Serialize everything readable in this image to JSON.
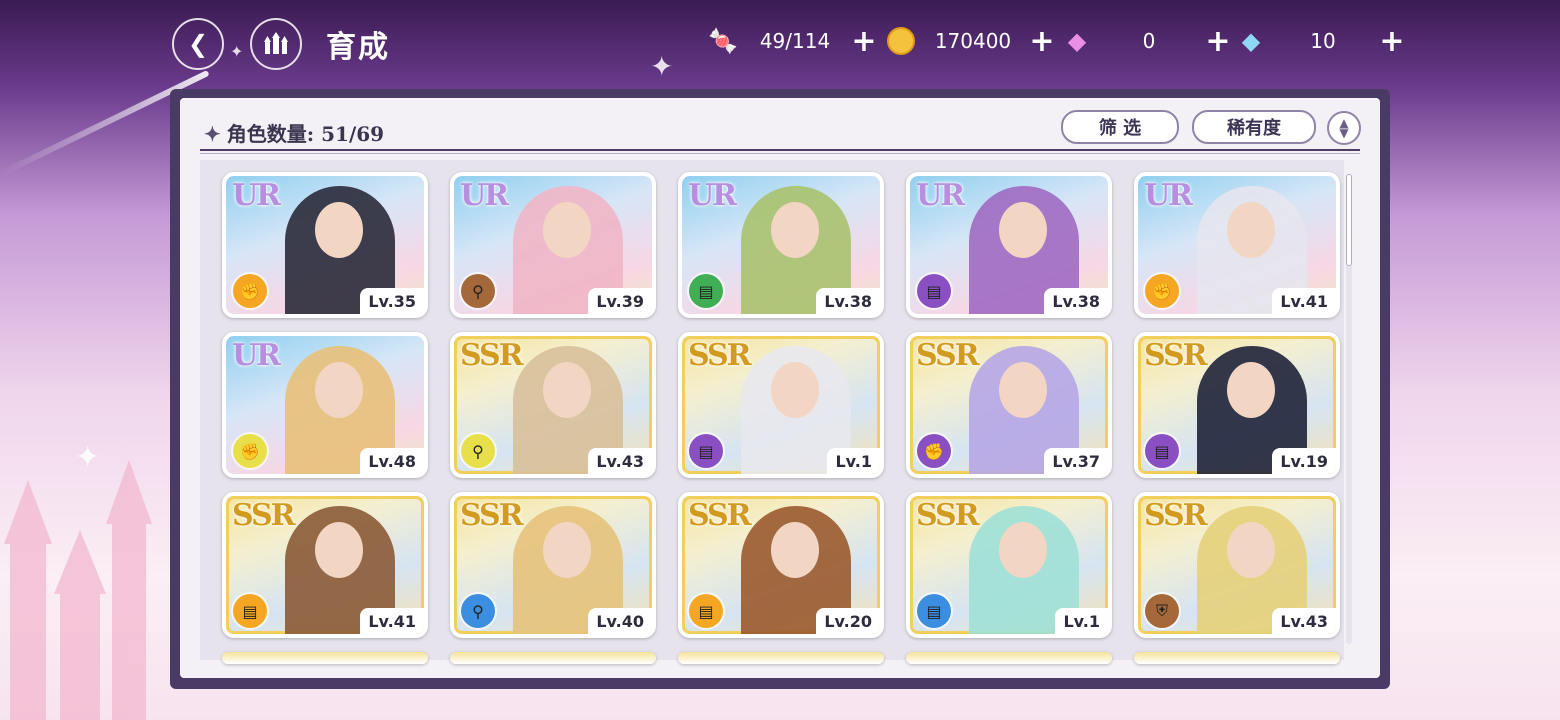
{
  "header": {
    "title": "育成",
    "resources": [
      {
        "icon": "candy-icon",
        "value": "49/114"
      },
      {
        "icon": "gold-coin-icon",
        "value": "170400"
      },
      {
        "icon": "pink-gem-icon",
        "value": "0"
      },
      {
        "icon": "blue-diamond-icon",
        "value": "10"
      }
    ]
  },
  "panel": {
    "count_label": "角色数量: 51/69",
    "filter_label": "筛 选",
    "sort_label": "稀有度"
  },
  "colors": {
    "ur_label": "#b88fe0",
    "ssr_label": "#d29a1e",
    "panel_border": "#4a3a66",
    "role_orange": "#f5a623",
    "role_brown": "#a4683a",
    "role_green": "#3fae55",
    "role_purple": "#8a4fc2",
    "role_yellow": "#e8e04a",
    "role_blue": "#3b8ee0"
  },
  "cards": [
    {
      "rarity": "UR",
      "level": "Lv.35",
      "role": "orange",
      "role_icon": "fist-icon",
      "hair": "#2a2a3a"
    },
    {
      "rarity": "UR",
      "level": "Lv.39",
      "role": "brown",
      "role_icon": "staff-icon",
      "hair": "#efb6c6"
    },
    {
      "rarity": "UR",
      "level": "Lv.38",
      "role": "green",
      "role_icon": "book-icon",
      "hair": "#a8c26e"
    },
    {
      "rarity": "UR",
      "level": "Lv.38",
      "role": "purple",
      "role_icon": "book-icon",
      "hair": "#a06ac2"
    },
    {
      "rarity": "UR",
      "level": "Lv.41",
      "role": "orange",
      "role_icon": "fist-icon",
      "hair": "#e6e6ee"
    },
    {
      "rarity": "UR",
      "level": "Lv.48",
      "role": "yellow",
      "role_icon": "fist-icon",
      "hair": "#e8c07a"
    },
    {
      "rarity": "SSR",
      "level": "Lv.43",
      "role": "yellow",
      "role_icon": "staff-icon",
      "hair": "#d8c09a"
    },
    {
      "rarity": "SSR",
      "level": "Lv.1",
      "role": "purple",
      "role_icon": "book-icon",
      "hair": "#e8e8ee"
    },
    {
      "rarity": "SSR",
      "level": "Lv.37",
      "role": "purple",
      "role_icon": "fist-icon",
      "hair": "#b6a6e6"
    },
    {
      "rarity": "SSR",
      "level": "Lv.19",
      "role": "purple",
      "role_icon": "book-icon",
      "hair": "#1e2238"
    },
    {
      "rarity": "SSR",
      "level": "Lv.41",
      "role": "orange",
      "role_icon": "book-icon",
      "hair": "#8a5a36"
    },
    {
      "rarity": "SSR",
      "level": "Lv.40",
      "role": "blue",
      "role_icon": "staff-icon",
      "hair": "#e6c27a"
    },
    {
      "rarity": "SSR",
      "level": "Lv.20",
      "role": "orange",
      "role_icon": "book-icon",
      "hair": "#9a5a2e"
    },
    {
      "rarity": "SSR",
      "level": "Lv.1",
      "role": "blue",
      "role_icon": "book-icon",
      "hair": "#9fe0d6"
    },
    {
      "rarity": "SSR",
      "level": "Lv.43",
      "role": "brown",
      "role_icon": "shield-icon",
      "hair": "#e6d07a"
    }
  ]
}
